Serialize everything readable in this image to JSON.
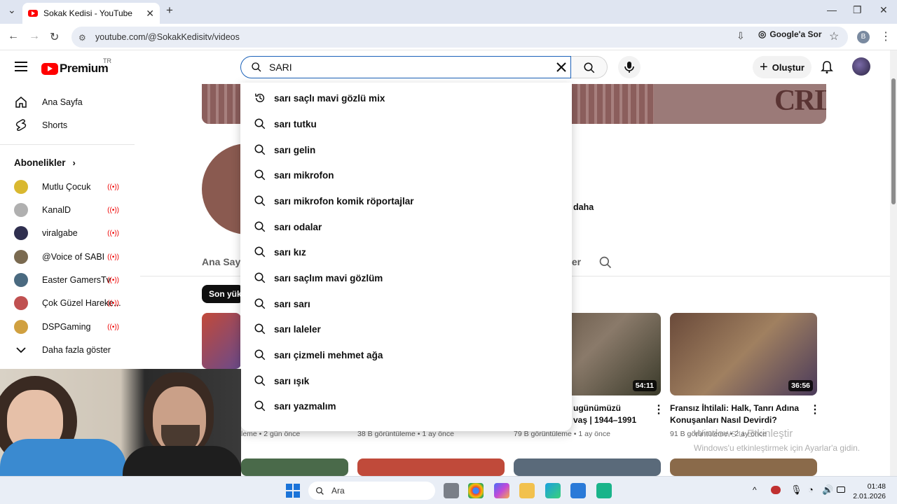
{
  "browser": {
    "tab_title": "Sokak Kedisi - YouTube",
    "url": "youtube.com/@SokakKedisitv/videos",
    "google_ask": "Google'a Sor",
    "profile_letter": "B"
  },
  "youtube": {
    "logo_text": "Premium",
    "logo_region": "TR",
    "search_value": "SARI",
    "create_label": "Oluştur"
  },
  "sidebar": {
    "home": "Ana Sayfa",
    "shorts": "Shorts",
    "subscriptions": "Abonelikler",
    "channels": [
      {
        "name": "Mutlu Çocuk",
        "color": "#d9b830"
      },
      {
        "name": "KanalD",
        "color": "#b0b0b0"
      },
      {
        "name": "viralgabe",
        "color": "#2f2f4f"
      },
      {
        "name": "@Voice of SABI",
        "color": "#7a6a50"
      },
      {
        "name": "Easter GamersTv",
        "color": "#4a6a80"
      },
      {
        "name": "Çok Güzel Hareke...",
        "color": "#c05050"
      },
      {
        "name": "DSPGaming",
        "color": "#d0a040"
      }
    ],
    "show_more": "Daha fazla göster"
  },
  "suggestions": [
    {
      "text": "sarı saçlı mavi gözlü mix",
      "icon": "history-icon"
    },
    {
      "text": "sarı tutku",
      "icon": "search-icon"
    },
    {
      "text": "sarı gelin",
      "icon": "search-icon"
    },
    {
      "text": "sarı mikrofon",
      "icon": "search-icon"
    },
    {
      "text": "sarı mikrofon komik röportajlar",
      "icon": "search-icon"
    },
    {
      "text": "sarı odalar",
      "icon": "search-icon"
    },
    {
      "text": "sarı kız",
      "icon": "search-icon"
    },
    {
      "text": "sarı saçlım mavi gözlüm",
      "icon": "search-icon"
    },
    {
      "text": "sarı sarı",
      "icon": "search-icon"
    },
    {
      "text": "sarı laleler",
      "icon": "search-icon"
    },
    {
      "text": "sarı çizmeli mehmet ağa",
      "icon": "search-icon"
    },
    {
      "text": "sarı ışık",
      "icon": "search-icon"
    },
    {
      "text": "sarı yazmalım",
      "icon": "search-icon"
    }
  ],
  "channel": {
    "banner_text": "CRIBE",
    "more_text": "daha",
    "tab_home": "Ana Sayfa",
    "tab_partial": "ler",
    "chip_label": "Son yüklenenler"
  },
  "videos": [
    {
      "title": "",
      "meta": "leme • 2 gün önce"
    },
    {
      "title": "",
      "meta": "38 B görüntüleme • 1 ay önce"
    },
    {
      "title": "ugünümüzü\nvaş | 1944–1991",
      "meta": "79 B görüntüleme • 1 ay önce",
      "duration": "54:11"
    },
    {
      "title": "Fransız İhtilali: Halk, Tanrı Adına Konuşanları Nasıl Devirdi?",
      "meta": "91 B görüntüleme • 2 ay önce",
      "duration": "36:56"
    }
  ],
  "watermark": {
    "line1": "Windows'u Etkinleştir",
    "line2": "Windows'u etkinleştirmek için Ayarlar'a gidin."
  },
  "taskbar": {
    "search_placeholder": "Ara",
    "time": "01:48",
    "date": "2.01.2026"
  }
}
